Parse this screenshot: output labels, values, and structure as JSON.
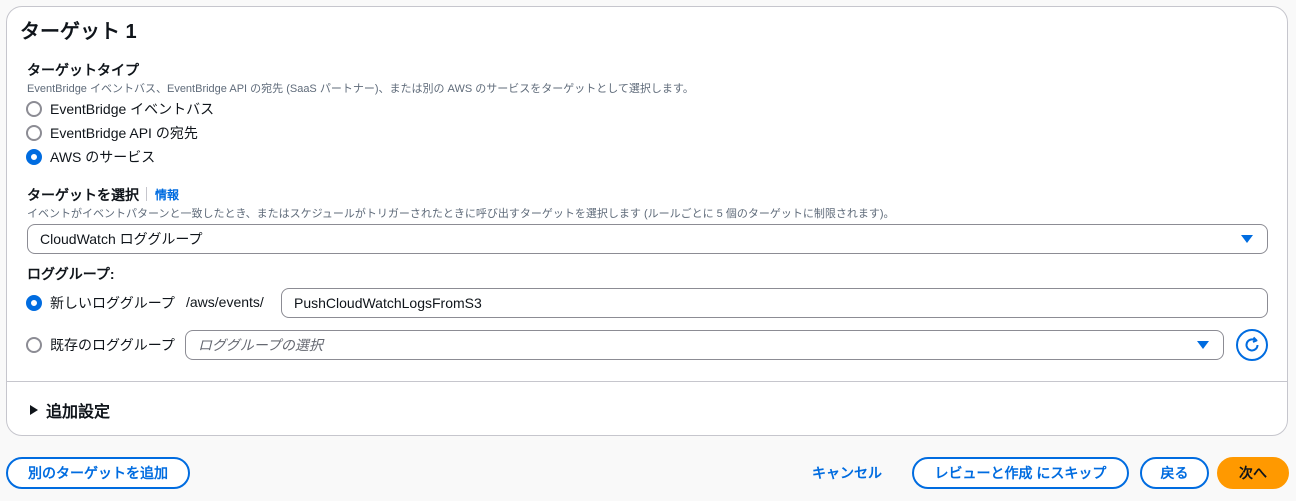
{
  "target": {
    "title": "ターゲット 1",
    "target_type": {
      "label": "ターゲットタイプ",
      "description": "EventBridge イベントバス、EventBridge API の宛先 (SaaS パートナー)、または別の AWS のサービスをターゲットとして選択します。",
      "options": [
        {
          "label": "EventBridge イベントバス",
          "selected": false
        },
        {
          "label": "EventBridge API の宛先",
          "selected": false
        },
        {
          "label": "AWS のサービス",
          "selected": true
        }
      ]
    },
    "select_target": {
      "label": "ターゲットを選択",
      "info": "情報",
      "description": "イベントがイベントパターンと一致したとき、またはスケジュールがトリガーされたときに呼び出すターゲットを選択します (ルールごとに 5 個のターゲットに制限されます)。",
      "value": "CloudWatch ロググループ"
    },
    "log_group": {
      "label": "ロググループ:",
      "new_option": "新しいロググループ",
      "prefix": "/aws/events/",
      "new_value": "PushCloudWatchLogsFromS3",
      "existing_option": "既存のロググループ",
      "existing_placeholder": "ロググループの選択"
    },
    "additional_settings": "追加設定"
  },
  "footer": {
    "add_target": "別のターゲットを追加",
    "cancel": "キャンセル",
    "skip_review": "レビューと作成 にスキップ",
    "back": "戻る",
    "next": "次へ"
  },
  "colors": {
    "accent": "#006ce0",
    "primary_button": "#ff9900"
  }
}
